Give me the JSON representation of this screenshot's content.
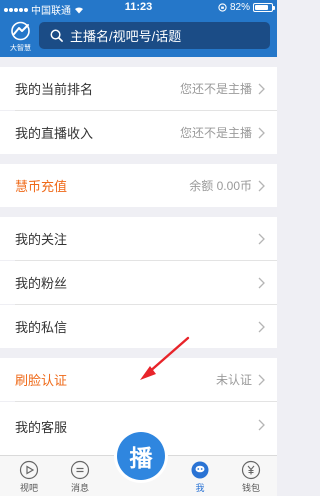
{
  "status_bar": {
    "carrier": "中国联通",
    "time": "11:23",
    "battery": "82%",
    "battery_level": 0.82
  },
  "header": {
    "logo_text": "大智慧",
    "search_placeholder": "主播名/视吧号/话题"
  },
  "menu": {
    "rank": {
      "label": "我的当前排名",
      "value": "您还不是主播"
    },
    "income": {
      "label": "我的直播收入",
      "value": "您还不是主播"
    },
    "recharge": {
      "label": "慧币充值",
      "value": "余额 0.00币"
    },
    "follow": {
      "label": "我的关注"
    },
    "fans": {
      "label": "我的粉丝"
    },
    "messages": {
      "label": "我的私信"
    },
    "face_auth": {
      "label": "刷脸认证",
      "value": "未认证"
    },
    "service": {
      "label": "我的客服"
    }
  },
  "tabbar": {
    "tabs": [
      {
        "label": "视吧"
      },
      {
        "label": "消息"
      },
      {
        "label": "我"
      },
      {
        "label": "钱包"
      }
    ],
    "live_label": "播"
  },
  "colors": {
    "header_blue": "#2577c9",
    "accent_orange": "#ef6a19",
    "live_blue": "#2f86df",
    "annotation_red": "#e8242a"
  }
}
